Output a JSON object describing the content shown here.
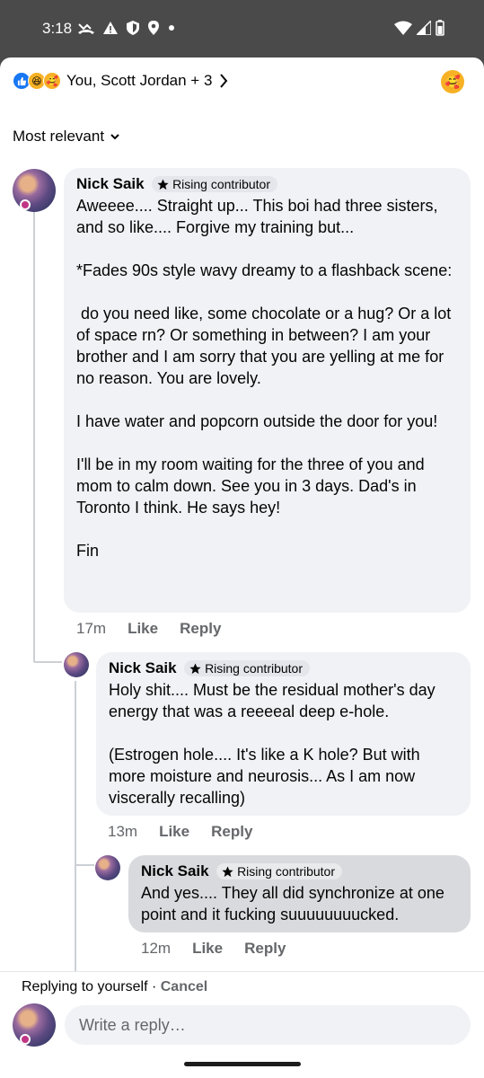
{
  "status": {
    "time": "3:18",
    "icons": [
      "missed-call-icon",
      "warning-icon",
      "shield-icon",
      "location-icon",
      "dot-icon"
    ],
    "right_icons": [
      "wifi-icon",
      "signal-icon",
      "battery-icon"
    ]
  },
  "reactions": {
    "summary": "You, Scott Jordan + 3",
    "types": [
      "like",
      "haha",
      "care"
    ]
  },
  "sort": {
    "label": "Most relevant"
  },
  "comments": [
    {
      "author": "Nick Saik",
      "badge": "Rising contributor",
      "text": "Aweeee.... Straight up... This boi had three sisters, and so like.... Forgive my training but...\n\n*Fades 90s style wavy dreamy to a flashback scene:\n\n do you need like, some chocolate or a hug? Or a lot of space rn? Or something in between? I am your brother and I am sorry that you are yelling at me for no reason. You are lovely.\n\nI have water and popcorn outside the door for you!\n\nI'll be in my room waiting for the three of you and mom to calm down. See you in 3 days. Dad's in Toronto I think. He says hey!\n\nFin",
      "time": "17m",
      "like": "Like",
      "reply": "Reply"
    },
    {
      "author": "Nick Saik",
      "badge": "Rising contributor",
      "text": "Holy shit.... Must be the residual mother's day energy that was a reeeeal deep e-hole.\n\n(Estrogen hole.... It's like a K hole? But with more moisture and neurosis... As I am now viscerally recalling)",
      "time": "13m",
      "like": "Like",
      "reply": "Reply"
    },
    {
      "author": "Nick Saik",
      "badge": "Rising contributor",
      "text": "And yes.... They all did synchronize at one point and it fucking suuuuuuuucked.",
      "time": "12m",
      "like": "Like",
      "reply": "Reply"
    }
  ],
  "reply_box": {
    "replying_text": "Replying to yourself · ",
    "cancel": "Cancel",
    "placeholder": "Write a reply…"
  }
}
